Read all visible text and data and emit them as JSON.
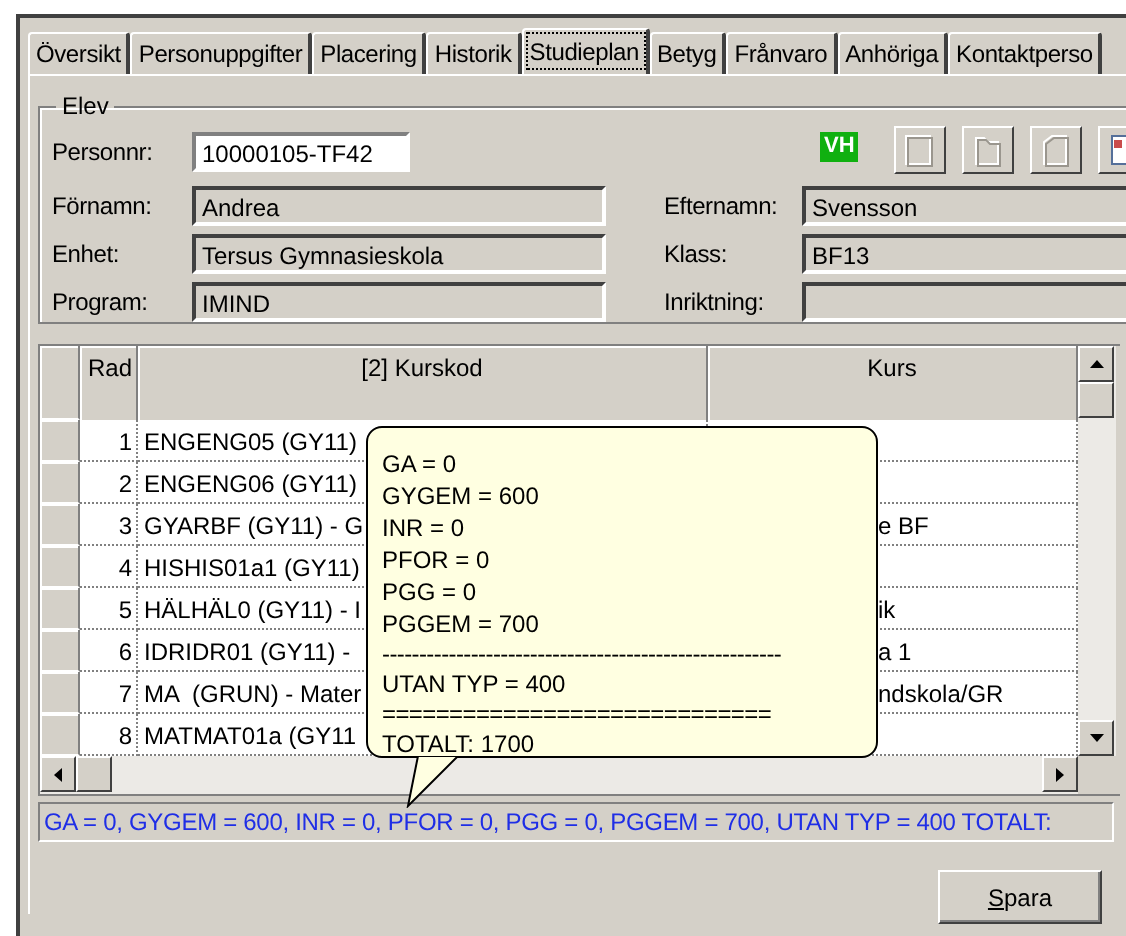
{
  "tabs": [
    {
      "label": "Översikt",
      "selected": false
    },
    {
      "label": "Personuppgifter",
      "selected": false
    },
    {
      "label": "Placering",
      "selected": false
    },
    {
      "label": "Historik",
      "selected": false
    },
    {
      "label": "Studieplan",
      "selected": true
    },
    {
      "label": "Betyg",
      "selected": false
    },
    {
      "label": "Frånvaro",
      "selected": false
    },
    {
      "label": "Anhöriga",
      "selected": false
    },
    {
      "label": "Kontaktperso",
      "selected": false
    }
  ],
  "student": {
    "title": "Elev",
    "badge": "VH",
    "fields": [
      {
        "label": "Personnr:",
        "value": "10000105-TF42",
        "editable": true
      },
      {
        "label": "Förnamn:",
        "value": "Andrea",
        "editable": false
      },
      {
        "label": "Efternamn:",
        "value": "Svensson",
        "editable": false
      },
      {
        "label": "Enhet:",
        "value": "Tersus Gymnasieskola",
        "editable": false
      },
      {
        "label": "Klass:",
        "value": "BF13",
        "editable": false
      },
      {
        "label": "Program:",
        "value": "IMIND",
        "editable": false
      },
      {
        "label": "Inriktning:",
        "editable": false
      }
    ]
  },
  "table": {
    "columns": [
      "Rad",
      "[2] Kurskod",
      "Kurs"
    ],
    "rows": [
      {
        "rad": "1",
        "kurskod": "ENGENG05 (GY11)",
        "kurs": ""
      },
      {
        "rad": "2",
        "kurskod": "ENGENG06 (GY11)",
        "kurs": ""
      },
      {
        "rad": "3",
        "kurskod": "GYARBF (GY11) - G",
        "kurs": "e BF"
      },
      {
        "rad": "4",
        "kurskod": "HISHIS01a1 (GY11)",
        "kurs": ""
      },
      {
        "rad": "5",
        "kurskod": "HÄLHÄL0 (GY11) - I",
        "kurs": "ik"
      },
      {
        "rad": "6",
        "kurskod": "IDRIDR01 (GY11) -",
        "kurs": "a 1"
      },
      {
        "rad": "7",
        "kurskod": "MA  (GRUN) - Mater",
        "kurs": "ndskola/GR"
      },
      {
        "rad": "8",
        "kurskod": "MATMAT01a (GY11",
        "kurs": ""
      }
    ]
  },
  "tooltip": {
    "lines": [
      {
        "kind": "text",
        "text": "GA = 0"
      },
      {
        "kind": "text",
        "text": "GYGEM = 600"
      },
      {
        "kind": "text",
        "text": "INR = 0"
      },
      {
        "kind": "text",
        "text": "PFOR = 0"
      },
      {
        "kind": "text",
        "text": "PGG = 0"
      },
      {
        "kind": "text",
        "text": "PGGEM = 700"
      },
      {
        "kind": "rule",
        "text": "------------------------------------------------------"
      },
      {
        "kind": "text",
        "text": "UTAN TYP = 400"
      },
      {
        "kind": "rule",
        "text": "============================="
      },
      {
        "kind": "text",
        "text": "TOTALT: 1700"
      }
    ]
  },
  "summary": "GA = 0, GYGEM = 600, INR = 0, PFOR = 0, PGG = 0, PGGEM = 700, UTAN TYP = 400  TOTALT:",
  "buttons": [
    "Spara"
  ]
}
